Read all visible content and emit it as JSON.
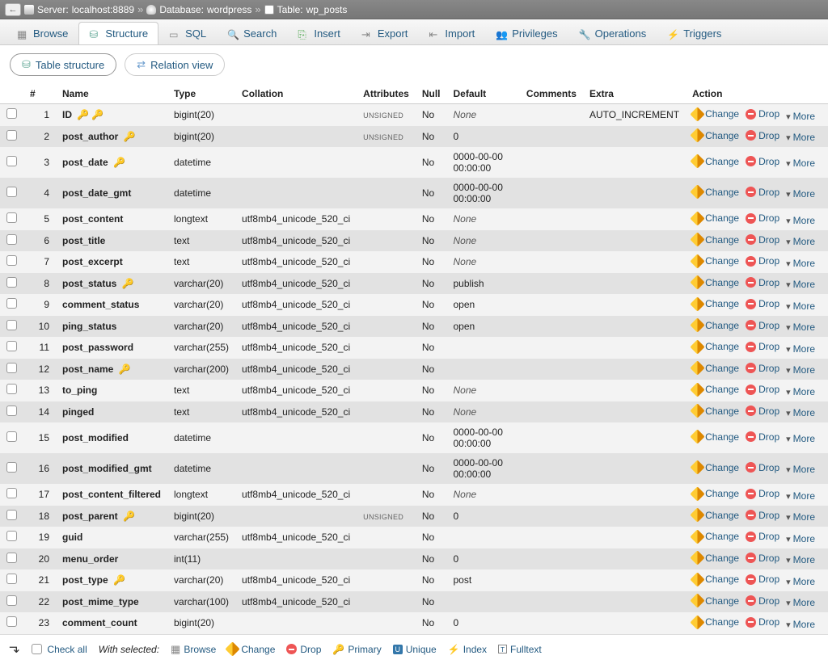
{
  "breadcrumb": {
    "server_label": "Server:",
    "server": "localhost:8889",
    "db_label": "Database:",
    "db": "wordpress",
    "table_label": "Table:",
    "table": "wp_posts"
  },
  "tabs": [
    {
      "icon": "ic-browse",
      "label": "Browse"
    },
    {
      "icon": "ic-structure",
      "label": "Structure",
      "active": true
    },
    {
      "icon": "ic-sql",
      "label": "SQL"
    },
    {
      "icon": "ic-search",
      "label": "Search"
    },
    {
      "icon": "ic-insert",
      "label": "Insert"
    },
    {
      "icon": "ic-export",
      "label": "Export"
    },
    {
      "icon": "ic-import",
      "label": "Import"
    },
    {
      "icon": "ic-privileges",
      "label": "Privileges"
    },
    {
      "icon": "ic-operations",
      "label": "Operations"
    },
    {
      "icon": "ic-triggers",
      "label": "Triggers"
    }
  ],
  "subtabs": {
    "structure": "Table structure",
    "relation": "Relation view"
  },
  "headers": {
    "num": "#",
    "name": "Name",
    "type": "Type",
    "collation": "Collation",
    "attributes": "Attributes",
    "null": "Null",
    "default": "Default",
    "comments": "Comments",
    "extra": "Extra",
    "action": "Action"
  },
  "action_labels": {
    "change": "Change",
    "drop": "Drop",
    "more": "More"
  },
  "columns": [
    {
      "n": 1,
      "name": "ID",
      "type": "bigint(20)",
      "coll": "",
      "attr": "UNSIGNED",
      "null": "No",
      "def": "None",
      "def_italic": true,
      "extra": "AUTO_INCREMENT",
      "gold_key": true,
      "grey_key": true
    },
    {
      "n": 2,
      "name": "post_author",
      "type": "bigint(20)",
      "coll": "",
      "attr": "UNSIGNED",
      "null": "No",
      "def": "0",
      "extra": "",
      "grey_key": true
    },
    {
      "n": 3,
      "name": "post_date",
      "type": "datetime",
      "coll": "",
      "attr": "",
      "null": "No",
      "def": "0000-00-00 00:00:00",
      "extra": "",
      "grey_key": true
    },
    {
      "n": 4,
      "name": "post_date_gmt",
      "type": "datetime",
      "coll": "",
      "attr": "",
      "null": "No",
      "def": "0000-00-00 00:00:00",
      "extra": ""
    },
    {
      "n": 5,
      "name": "post_content",
      "type": "longtext",
      "coll": "utf8mb4_unicode_520_ci",
      "attr": "",
      "null": "No",
      "def": "None",
      "def_italic": true,
      "extra": ""
    },
    {
      "n": 6,
      "name": "post_title",
      "type": "text",
      "coll": "utf8mb4_unicode_520_ci",
      "attr": "",
      "null": "No",
      "def": "None",
      "def_italic": true,
      "extra": ""
    },
    {
      "n": 7,
      "name": "post_excerpt",
      "type": "text",
      "coll": "utf8mb4_unicode_520_ci",
      "attr": "",
      "null": "No",
      "def": "None",
      "def_italic": true,
      "extra": ""
    },
    {
      "n": 8,
      "name": "post_status",
      "type": "varchar(20)",
      "coll": "utf8mb4_unicode_520_ci",
      "attr": "",
      "null": "No",
      "def": "publish",
      "extra": "",
      "grey_key": true
    },
    {
      "n": 9,
      "name": "comment_status",
      "type": "varchar(20)",
      "coll": "utf8mb4_unicode_520_ci",
      "attr": "",
      "null": "No",
      "def": "open",
      "extra": ""
    },
    {
      "n": 10,
      "name": "ping_status",
      "type": "varchar(20)",
      "coll": "utf8mb4_unicode_520_ci",
      "attr": "",
      "null": "No",
      "def": "open",
      "extra": ""
    },
    {
      "n": 11,
      "name": "post_password",
      "type": "varchar(255)",
      "coll": "utf8mb4_unicode_520_ci",
      "attr": "",
      "null": "No",
      "def": "",
      "extra": ""
    },
    {
      "n": 12,
      "name": "post_name",
      "type": "varchar(200)",
      "coll": "utf8mb4_unicode_520_ci",
      "attr": "",
      "null": "No",
      "def": "",
      "extra": "",
      "grey_key": true
    },
    {
      "n": 13,
      "name": "to_ping",
      "type": "text",
      "coll": "utf8mb4_unicode_520_ci",
      "attr": "",
      "null": "No",
      "def": "None",
      "def_italic": true,
      "extra": ""
    },
    {
      "n": 14,
      "name": "pinged",
      "type": "text",
      "coll": "utf8mb4_unicode_520_ci",
      "attr": "",
      "null": "No",
      "def": "None",
      "def_italic": true,
      "extra": ""
    },
    {
      "n": 15,
      "name": "post_modified",
      "type": "datetime",
      "coll": "",
      "attr": "",
      "null": "No",
      "def": "0000-00-00 00:00:00",
      "extra": ""
    },
    {
      "n": 16,
      "name": "post_modified_gmt",
      "type": "datetime",
      "coll": "",
      "attr": "",
      "null": "No",
      "def": "0000-00-00 00:00:00",
      "extra": ""
    },
    {
      "n": 17,
      "name": "post_content_filtered",
      "type": "longtext",
      "coll": "utf8mb4_unicode_520_ci",
      "attr": "",
      "null": "No",
      "def": "None",
      "def_italic": true,
      "extra": ""
    },
    {
      "n": 18,
      "name": "post_parent",
      "type": "bigint(20)",
      "coll": "",
      "attr": "UNSIGNED",
      "null": "No",
      "def": "0",
      "extra": "",
      "grey_key": true
    },
    {
      "n": 19,
      "name": "guid",
      "type": "varchar(255)",
      "coll": "utf8mb4_unicode_520_ci",
      "attr": "",
      "null": "No",
      "def": "",
      "extra": ""
    },
    {
      "n": 20,
      "name": "menu_order",
      "type": "int(11)",
      "coll": "",
      "attr": "",
      "null": "No",
      "def": "0",
      "extra": ""
    },
    {
      "n": 21,
      "name": "post_type",
      "type": "varchar(20)",
      "coll": "utf8mb4_unicode_520_ci",
      "attr": "",
      "null": "No",
      "def": "post",
      "extra": "",
      "grey_key": true
    },
    {
      "n": 22,
      "name": "post_mime_type",
      "type": "varchar(100)",
      "coll": "utf8mb4_unicode_520_ci",
      "attr": "",
      "null": "No",
      "def": "",
      "extra": ""
    },
    {
      "n": 23,
      "name": "comment_count",
      "type": "bigint(20)",
      "coll": "",
      "attr": "",
      "null": "No",
      "def": "0",
      "extra": ""
    }
  ],
  "footer": {
    "check_all": "Check all",
    "with_selected": "With selected:",
    "browse": "Browse",
    "change": "Change",
    "drop": "Drop",
    "primary": "Primary",
    "unique": "Unique",
    "index": "Index",
    "fulltext": "Fulltext"
  }
}
